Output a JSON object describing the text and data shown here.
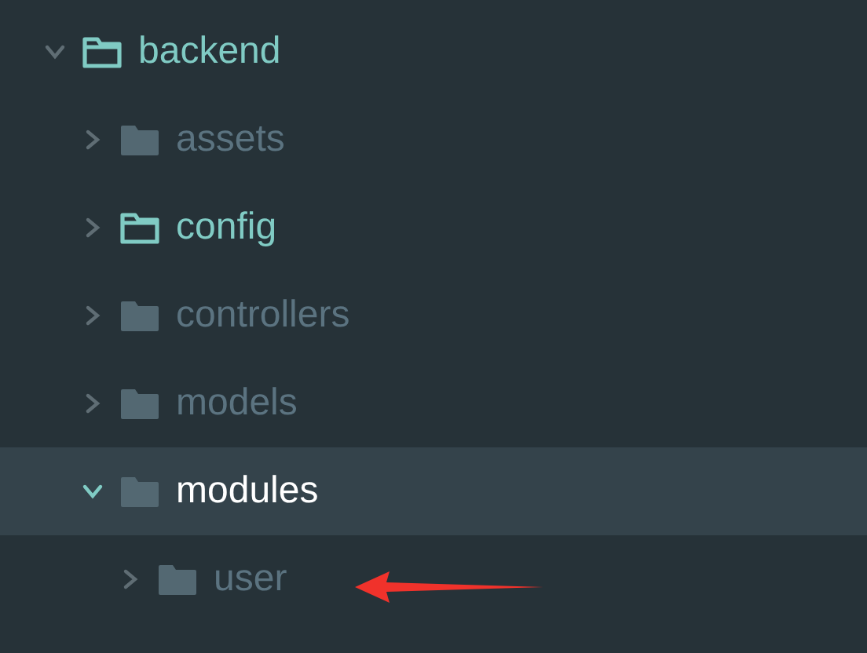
{
  "tree": [
    {
      "label": "backend",
      "expanded": true,
      "selected": false,
      "modified": true,
      "children": [
        {
          "label": "assets",
          "expanded": false,
          "selected": false,
          "modified": false
        },
        {
          "label": "config",
          "expanded": false,
          "selected": false,
          "modified": true
        },
        {
          "label": "controllers",
          "expanded": false,
          "selected": false,
          "modified": false
        },
        {
          "label": "models",
          "expanded": false,
          "selected": false,
          "modified": false
        },
        {
          "label": "modules",
          "expanded": true,
          "selected": true,
          "modified": false,
          "children": [
            {
              "label": "user",
              "expanded": false,
              "selected": false,
              "modified": false
            }
          ]
        }
      ]
    }
  ]
}
